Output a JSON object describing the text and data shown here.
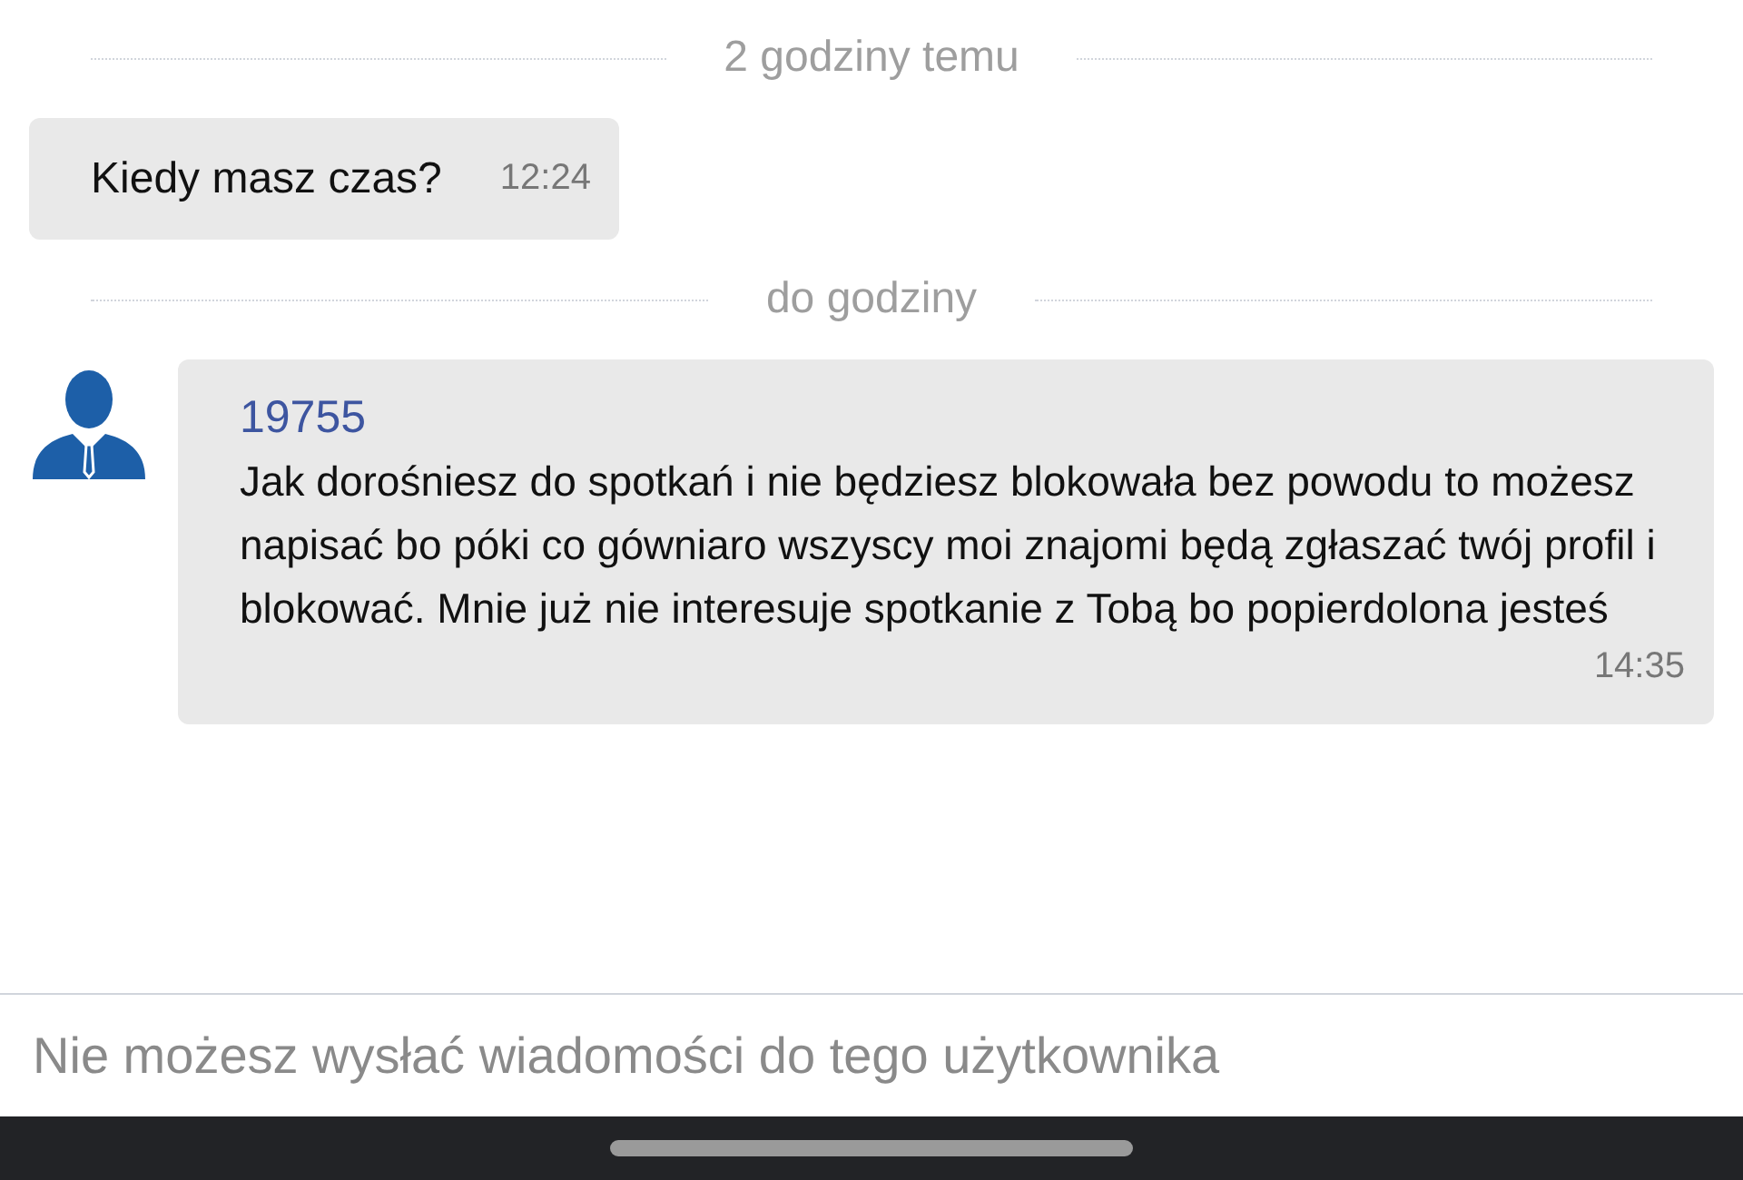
{
  "messages": [
    {
      "kind": "divider",
      "label": "2 godziny temu"
    },
    {
      "kind": "plain",
      "text": "Kiedy masz czas?",
      "time": "12:24"
    },
    {
      "kind": "divider",
      "label": "do godziny"
    },
    {
      "kind": "with_sender",
      "sender": "19755",
      "text": "Jak dorośniesz do spotkań i nie będziesz blokowała bez powodu to możesz napisać bo póki co gówniaro wszyscy moi znajomi będą zgłaszać twój profil i blokować. Mnie już nie interesuje spotkanie z Tobą bo popierdolona jesteś",
      "time": "14:35"
    }
  ],
  "composer": {
    "placeholder": "Nie możesz wysłać wiadomości do tego użytkownika",
    "disabled": true
  }
}
